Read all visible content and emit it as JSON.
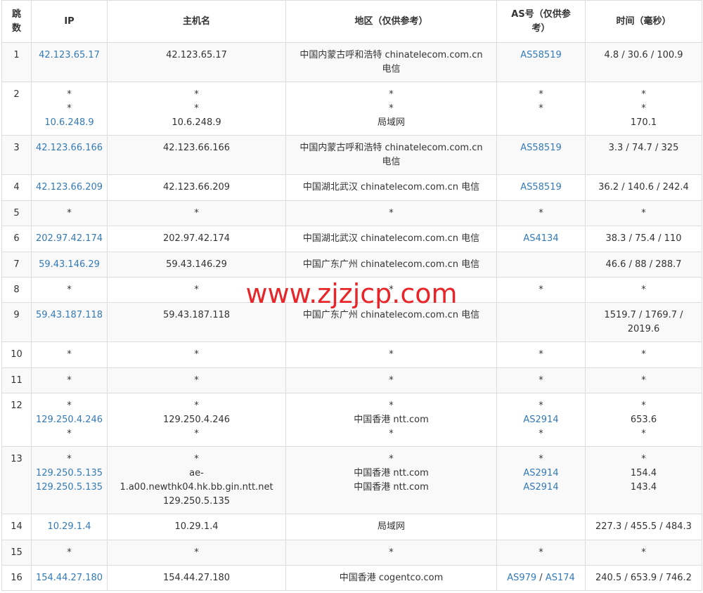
{
  "headers": {
    "hop": [
      "跳",
      "数"
    ],
    "ip": "IP",
    "host": "主机名",
    "region": "地区（仅供参考）",
    "as": [
      "AS号（仅供参",
      "考）"
    ],
    "time": "时间（毫秒）"
  },
  "rows": [
    {
      "hop": "1",
      "ip": [
        "42.123.65.17"
      ],
      "host": [
        "42.123.65.17"
      ],
      "region": [
        "中国内蒙古呼和浩特 chinatelecom.com.cn",
        "电信"
      ],
      "as": [
        [
          "AS58519"
        ]
      ],
      "time": [
        "4.8 / 30.6 / 100.9"
      ]
    },
    {
      "hop": "2",
      "ip": [
        "*",
        "*",
        "10.6.248.9"
      ],
      "host": [
        "*",
        "*",
        "10.6.248.9"
      ],
      "region": [
        "*",
        "*",
        "局域网"
      ],
      "as": [
        [
          "*"
        ],
        [
          "*"
        ]
      ],
      "time": [
        "*",
        "*",
        "170.1"
      ]
    },
    {
      "hop": "3",
      "ip": [
        "42.123.66.166"
      ],
      "host": [
        "42.123.66.166"
      ],
      "region": [
        "中国内蒙古呼和浩特 chinatelecom.com.cn",
        "电信"
      ],
      "as": [
        [
          "AS58519"
        ]
      ],
      "time": [
        "3.3 / 74.7 / 325"
      ]
    },
    {
      "hop": "4",
      "ip": [
        "42.123.66.209"
      ],
      "host": [
        "42.123.66.209"
      ],
      "region": [
        "中国湖北武汉 chinatelecom.com.cn 电信"
      ],
      "as": [
        [
          "AS58519"
        ]
      ],
      "time": [
        "36.2 / 140.6 / 242.4"
      ]
    },
    {
      "hop": "5",
      "ip": [
        "*"
      ],
      "host": [
        "*"
      ],
      "region": [
        "*"
      ],
      "as": [
        [
          "*"
        ]
      ],
      "time": [
        "*"
      ]
    },
    {
      "hop": "6",
      "ip": [
        "202.97.42.174"
      ],
      "host": [
        "202.97.42.174"
      ],
      "region": [
        "中国湖北武汉 chinatelecom.com.cn 电信"
      ],
      "as": [
        [
          "AS4134"
        ]
      ],
      "time": [
        "38.3 / 75.4 / 110"
      ]
    },
    {
      "hop": "7",
      "ip": [
        "59.43.146.29"
      ],
      "host": [
        "59.43.146.29"
      ],
      "region": [
        "中国广东广州 chinatelecom.com.cn 电信"
      ],
      "as": [],
      "time": [
        "46.6 / 88 / 288.7"
      ]
    },
    {
      "hop": "8",
      "ip": [
        "*"
      ],
      "host": [
        "*"
      ],
      "region": [
        "*"
      ],
      "as": [
        [
          "*"
        ]
      ],
      "time": [
        "*"
      ]
    },
    {
      "hop": "9",
      "ip": [
        "59.43.187.118"
      ],
      "host": [
        "59.43.187.118"
      ],
      "region": [
        "中国广东广州 chinatelecom.com.cn 电信"
      ],
      "as": [],
      "time": [
        "1519.7 / 1769.7 /",
        "2019.6"
      ]
    },
    {
      "hop": "10",
      "ip": [
        "*"
      ],
      "host": [
        "*"
      ],
      "region": [
        "*"
      ],
      "as": [
        [
          "*"
        ]
      ],
      "time": [
        "*"
      ]
    },
    {
      "hop": "11",
      "ip": [
        "*"
      ],
      "host": [
        "*"
      ],
      "region": [
        "*"
      ],
      "as": [
        [
          "*"
        ]
      ],
      "time": [
        "*"
      ]
    },
    {
      "hop": "12",
      "ip": [
        "*",
        "129.250.4.246",
        "*"
      ],
      "host": [
        "*",
        "129.250.4.246",
        "*"
      ],
      "region": [
        "*",
        "中国香港 ntt.com",
        "*"
      ],
      "as": [
        [
          "*"
        ],
        [
          "AS2914"
        ],
        [
          "*"
        ]
      ],
      "time": [
        "*",
        "653.6",
        "*"
      ]
    },
    {
      "hop": "13",
      "ip": [
        "*",
        "129.250.5.135",
        "129.250.5.135"
      ],
      "host": [
        "*",
        "ae-",
        "1.a00.newthk04.hk.bb.gin.ntt.net",
        "129.250.5.135"
      ],
      "region": [
        "*",
        "中国香港 ntt.com",
        "中国香港 ntt.com"
      ],
      "as": [
        [
          "*"
        ],
        [
          "AS2914"
        ],
        [
          "AS2914"
        ]
      ],
      "time": [
        "*",
        "154.4",
        "143.4"
      ]
    },
    {
      "hop": "14",
      "ip": [
        "10.29.1.4"
      ],
      "host": [
        "10.29.1.4"
      ],
      "region": [
        "局域网"
      ],
      "as": [],
      "time": [
        "227.3 / 455.5 / 484.3"
      ]
    },
    {
      "hop": "15",
      "ip": [
        "*"
      ],
      "host": [
        "*"
      ],
      "region": [
        "*"
      ],
      "as": [
        [
          "*"
        ]
      ],
      "time": [
        "*"
      ]
    },
    {
      "hop": "16",
      "ip": [
        "154.44.27.180"
      ],
      "host": [
        "154.44.27.180"
      ],
      "region": [
        "中国香港 cogentco.com"
      ],
      "as": [
        [
          "AS979",
          "AS174"
        ]
      ],
      "time": [
        "240.5 / 653.9 / 746.2"
      ]
    }
  ],
  "watermark": "www.zjzjcp.com",
  "colors": {
    "link": "#337ab7",
    "watermark": "#e8262a",
    "border": "#dddddd",
    "stripe": "#f9f9f9"
  }
}
